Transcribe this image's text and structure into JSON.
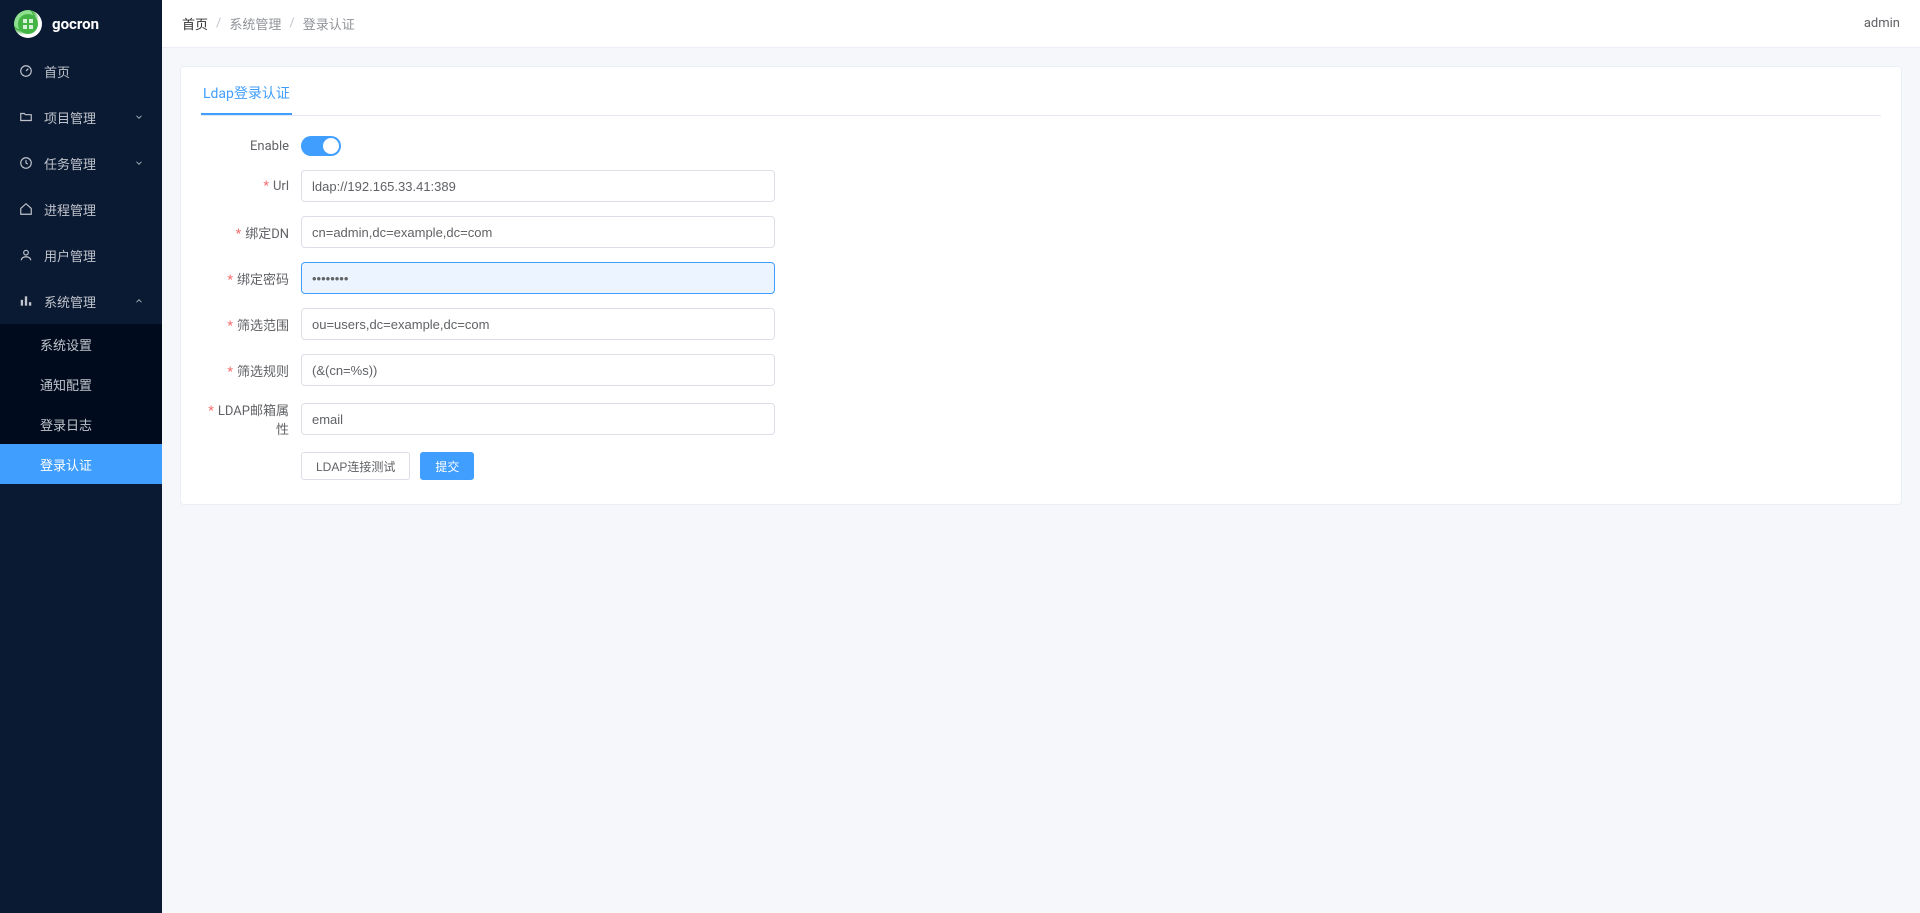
{
  "brand": "gocron",
  "sidebar": {
    "items": [
      {
        "label": "首页"
      },
      {
        "label": "项目管理"
      },
      {
        "label": "任务管理"
      },
      {
        "label": "进程管理"
      },
      {
        "label": "用户管理"
      },
      {
        "label": "系统管理"
      }
    ],
    "system_sub": [
      {
        "label": "系统设置"
      },
      {
        "label": "通知配置"
      },
      {
        "label": "登录日志"
      },
      {
        "label": "登录认证"
      }
    ]
  },
  "breadcrumb": {
    "home": "首页",
    "system": "系统管理",
    "current": "登录认证"
  },
  "user": "admin",
  "tab": "Ldap登录认证",
  "form": {
    "enable_label": "Enable",
    "url_label": "Url",
    "url_value": "ldap://192.165.33.41:389",
    "binddn_label": "绑定DN",
    "binddn_value": "cn=admin,dc=example,dc=com",
    "bindpw_label": "绑定密码",
    "bindpw_value": "••••••••",
    "scope_label": "筛选范围",
    "scope_value": "ou=users,dc=example,dc=com",
    "filter_label": "筛选规则",
    "filter_value": "(&(cn=%s))",
    "mail_label": "LDAP邮箱属性",
    "mail_value": "email",
    "test_btn": "LDAP连接测试",
    "submit_btn": "提交"
  }
}
